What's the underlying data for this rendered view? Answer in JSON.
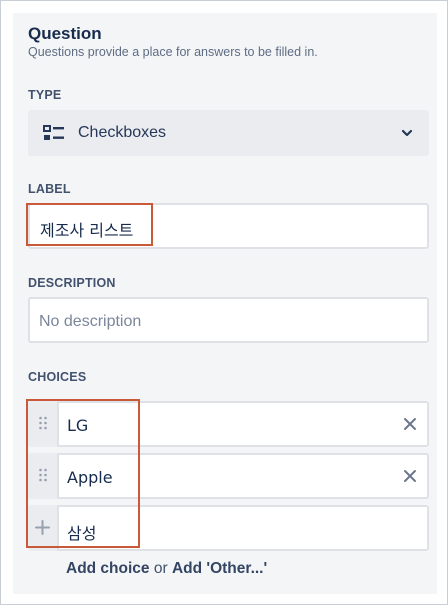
{
  "header": {
    "title": "Question",
    "subtitle": "Questions provide a place for answers to be filled in."
  },
  "type_section": {
    "label": "TYPE",
    "selected": "Checkboxes",
    "icon": "checklist-icon"
  },
  "label_section": {
    "label": "LABEL",
    "value": "제조사 리스트"
  },
  "description_section": {
    "label": "DESCRIPTION",
    "placeholder": "No description"
  },
  "choices_section": {
    "label": "CHOICES",
    "items": [
      {
        "text": "LG"
      },
      {
        "text": "Apple"
      }
    ],
    "new_item": "삼성",
    "add_choice": "Add choice",
    "or": "or",
    "add_other": "Add 'Other...'"
  },
  "colors": {
    "panel_bg": "#f4f5f7",
    "highlight": "#c85a3a",
    "text": "#172b4d"
  }
}
